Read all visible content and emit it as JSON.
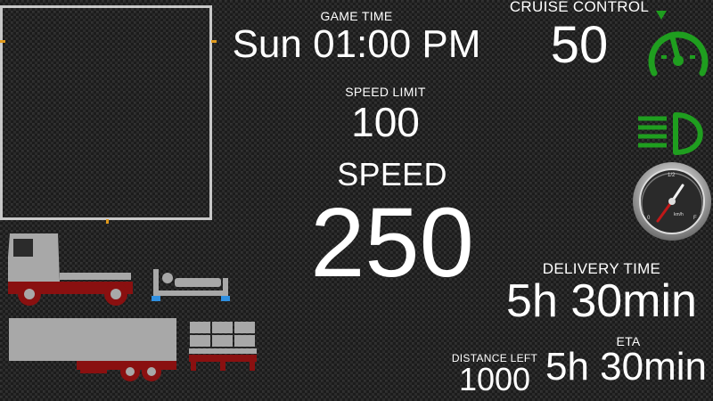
{
  "game_time": {
    "label": "GAME TIME",
    "value": "Sun 01:00 PM"
  },
  "cruise_control": {
    "label": "CRUISE CONTROL",
    "value": "50"
  },
  "speed_limit": {
    "label": "SPEED LIMIT",
    "value": "100"
  },
  "speed": {
    "label": "SPEED",
    "value": "250"
  },
  "delivery_time": {
    "label": "DELIVERY TIME",
    "value": "5h 30min"
  },
  "eta": {
    "label": "ETA",
    "value": "5h 30min"
  },
  "distance_left": {
    "label": "DISTANCE LEFT",
    "value": "1000"
  },
  "gauge": {
    "tick_top": "1/2",
    "tick_left": "0",
    "tick_right": "F",
    "unit": "km/h"
  },
  "icons": {
    "cruise": "cruise-control-icon",
    "headlights": "headlights-icon",
    "fuel_gauge": "fuel-gauge-icon",
    "truck": "truck-icon",
    "sleep": "sleep-bed-icon",
    "trailer": "trailer-icon",
    "cargo": "cargo-pallet-icon"
  },
  "colors": {
    "indicator_green": "#1f9e1f",
    "damage_red": "#8a1010",
    "vehicle_gray": "#a8a8a8",
    "bed_blue": "#2f8fe0",
    "map_border": "#c8c8c8"
  }
}
